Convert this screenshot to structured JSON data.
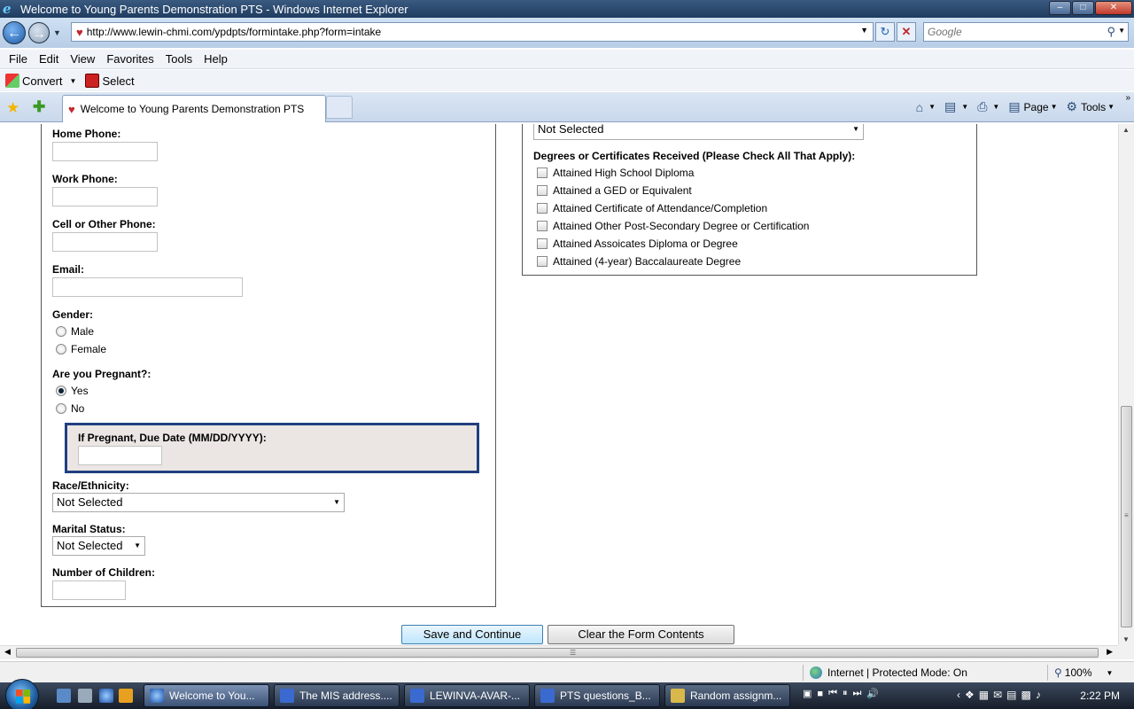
{
  "window": {
    "title": "Welcome to Young Parents Demonstration PTS - Windows Internet Explorer"
  },
  "address_bar": {
    "url": "http://www.lewin-chmi.com/ypdpts/formintake.php?form=intake",
    "search_placeholder": "Google"
  },
  "menu": [
    "File",
    "Edit",
    "View",
    "Favorites",
    "Tools",
    "Help"
  ],
  "command_bar": {
    "convert": "Convert",
    "select": "Select",
    "page": "Page",
    "tools": "Tools"
  },
  "tab": {
    "title": "Welcome to Young Parents Demonstration PTS"
  },
  "form": {
    "home_phone_label": "Home Phone:",
    "work_phone_label": "Work Phone:",
    "cell_phone_label": "Cell or Other Phone:",
    "email_label": "Email:",
    "gender_label": "Gender:",
    "gender_options": [
      "Male",
      "Female"
    ],
    "pregnant_label": "Are you Pregnant?:",
    "pregnant_options": [
      "Yes",
      "No"
    ],
    "pregnant_selected": "Yes",
    "due_date_label": "If Pregnant, Due Date (MM/DD/YYYY):",
    "race_label": "Race/Ethnicity:",
    "race_value": "Not Selected",
    "marital_label": "Marital Status:",
    "marital_value": "Not Selected",
    "children_label": "Number of Children:",
    "top_select_value": "Not Selected",
    "degrees_label": "Degrees or Certificates Received (Please Check All That Apply):",
    "degrees": [
      "Attained High School Diploma",
      "Attained a GED or Equivalent",
      "Attained Certificate of Attendance/Completion",
      "Attained Other Post-Secondary Degree or Certification",
      "Attained Assoicates Diploma or Degree",
      "Attained (4-year) Baccalaureate Degree"
    ],
    "save_button": "Save and Continue",
    "clear_button": "Clear the Form Contents"
  },
  "status_bar": {
    "zone": "Internet | Protected Mode: On",
    "zoom": "100%"
  },
  "taskbar": {
    "items": [
      "Welcome to You...",
      "The MIS address....",
      "LEWINVA-AVAR-...",
      "PTS questions_B...",
      "Random assignm..."
    ],
    "clock": "2:22 PM"
  },
  "colors": {
    "due_box_border": "#1f3f7f",
    "due_box_bg": "#ebe6e4"
  }
}
